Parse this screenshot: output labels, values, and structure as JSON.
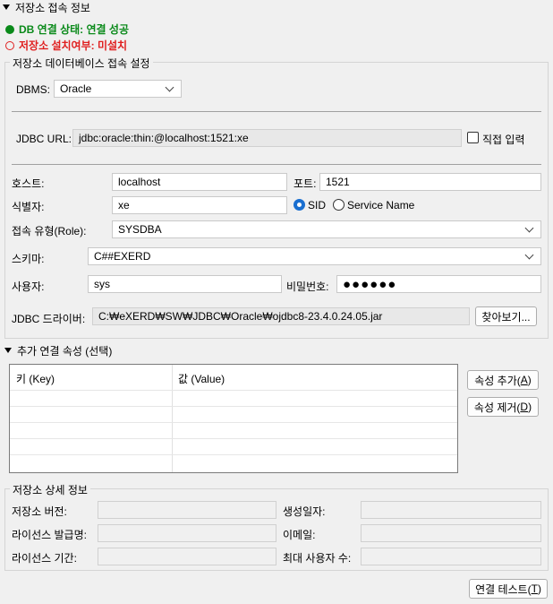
{
  "repo_info": {
    "section_title": "저장소 접속 정보",
    "db_status": "DB 연결 상태: 연결 성공",
    "install_status": "저장소 설치여부: 미설치",
    "colors": {
      "success": "#0a8a1a",
      "error": "#e02020"
    }
  },
  "db_settings": {
    "legend": "저장소 데이터베이스 접속 설정",
    "dbms_label": "DBMS:",
    "dbms_value": "Oracle",
    "jdbc_url_label": "JDBC URL:",
    "jdbc_url_value": "jdbc:oracle:thin:@localhost:1521:xe",
    "direct_input_label": "직접 입력",
    "host_label": "호스트:",
    "host_value": "localhost",
    "port_label": "포트:",
    "port_value": "1521",
    "identifier_label": "식별자:",
    "identifier_value": "xe",
    "sid_label": "SID",
    "service_name_label": "Service Name",
    "role_label": "접속 유형(Role):",
    "role_value": "SYSDBA",
    "schema_label": "스키마:",
    "schema_value": "C##EXERD",
    "user_label": "사용자:",
    "user_value": "sys",
    "password_label": "비밀번호:",
    "password_value": "●●●●●●",
    "driver_label": "JDBC 드라이버:",
    "driver_value": "C:₩eXERD₩SW₩JDBC₩Oracle₩ojdbc8-23.4.0.24.05.jar",
    "browse_label": "찾아보기..."
  },
  "extra_props": {
    "section_title": "추가 연결 속성 (선택)",
    "columns": [
      "키 (Key)",
      "값 (Value)"
    ],
    "add_label": "속성 추가(",
    "add_key": "A",
    "remove_label": "속성 제거(",
    "remove_key": "D"
  },
  "repo_details": {
    "legend": "저장소 상세 정보",
    "version_label": "저장소 버전:",
    "created_label": "생성일자:",
    "licensee_label": "라이선스 발급명:",
    "email_label": "이메일:",
    "license_period_label": "라이선스 기간:",
    "max_users_label": "최대 사용자 수:"
  },
  "footer": {
    "test_label": "연결 테스트(",
    "test_key": "T"
  }
}
